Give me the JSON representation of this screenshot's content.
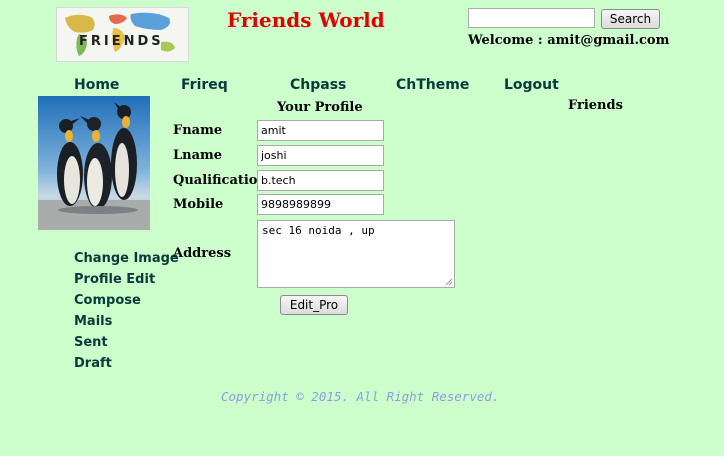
{
  "header": {
    "site_title": "Friends World",
    "logo_text": "FRIENDS",
    "search_placeholder": "",
    "search_value": "",
    "search_label": "Search",
    "welcome_text": "Welcome : amit@gmail.com"
  },
  "nav": {
    "items": [
      {
        "label": "Home"
      },
      {
        "label": "Frireq"
      },
      {
        "label": "Chpass"
      },
      {
        "label": "ChTheme"
      },
      {
        "label": "Logout"
      }
    ]
  },
  "sidebar": {
    "links": [
      {
        "label": "Change Image"
      },
      {
        "label": "Profile Edit"
      },
      {
        "label": "Compose"
      },
      {
        "label": "Mails"
      },
      {
        "label": "Sent"
      },
      {
        "label": "Draft"
      }
    ]
  },
  "profile": {
    "heading": "Your Profile",
    "fields": [
      {
        "label": "Fname",
        "value": "amit"
      },
      {
        "label": "Lname",
        "value": "joshi"
      },
      {
        "label": "Qualification",
        "value": "b.tech"
      },
      {
        "label": "Mobile",
        "value": "9898989899"
      }
    ],
    "address_label": "Address",
    "address_value": "sec 16 noida , up",
    "edit_button": "Edit_Pro"
  },
  "friends": {
    "heading": "Friends"
  },
  "footer": {
    "copyright": "Copyright © 2015. All Right Reserved."
  }
}
